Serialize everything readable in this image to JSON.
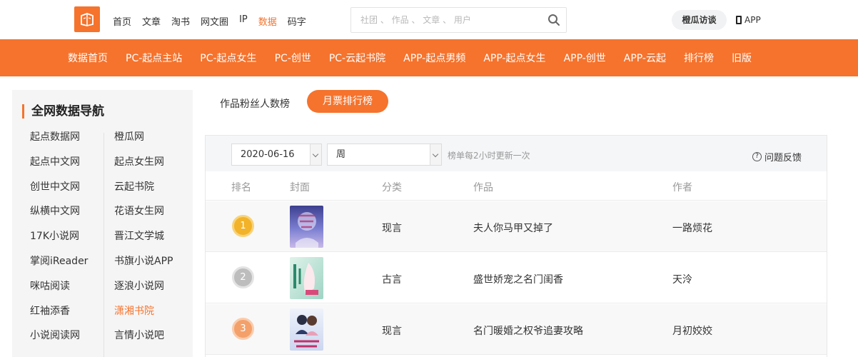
{
  "topbar": {
    "nav": [
      {
        "label": "首页",
        "active": false
      },
      {
        "label": "文章",
        "active": false
      },
      {
        "label": "淘书",
        "active": false
      },
      {
        "label": "网文圈",
        "active": false
      },
      {
        "label": "IP",
        "active": false
      },
      {
        "label": "数据",
        "active": true
      },
      {
        "label": "码字",
        "active": false
      }
    ],
    "search_placeholder": "社团 、 作品 、 文章 、 用户",
    "chengua_label": "橙瓜访谈",
    "app_label": "APP"
  },
  "mainnav": [
    "数据首页",
    "PC-起点主站",
    "PC-起点女生",
    "PC-创世",
    "PC-云起书院",
    "APP-起点男频",
    "APP-起点女生",
    "APP-创世",
    "APP-云起",
    "排行榜",
    "旧版"
  ],
  "sidebar": {
    "title": "全网数据导航",
    "col1": [
      "起点数据网",
      "起点中文网",
      "创世中文网",
      "纵横中文网",
      "17K小说网",
      "掌阅iReader",
      "咪咕阅读",
      "红袖添香",
      "小说阅读网"
    ],
    "col2": [
      "橙瓜网",
      "起点女生网",
      "云起书院",
      "花语女生网",
      "晋江文学城",
      "书旗小说APP",
      "逐浪小说网",
      "潇湘书院",
      "言情小说吧"
    ],
    "active": "潇湘书院"
  },
  "tabs": {
    "fans": "作品粉丝人数榜",
    "monthly": "月票排行榜"
  },
  "filter": {
    "date": "2020-06-16",
    "period": "周",
    "note": "榜单每2小时更新一次",
    "feedback": "问题反馈"
  },
  "table": {
    "headers": {
      "rank": "排名",
      "cover": "封面",
      "category": "分类",
      "title": "作品",
      "author": "作者"
    },
    "rows": [
      {
        "rank": "1",
        "category": "现言",
        "title": "夫人你马甲又掉了",
        "author": "一路烦花"
      },
      {
        "rank": "2",
        "category": "古言",
        "title": "盛世娇宠之名门闺香",
        "author": "天泠"
      },
      {
        "rank": "3",
        "category": "现言",
        "title": "名门暖婚之权爷追妻攻略",
        "author": "月初姣姣"
      }
    ]
  },
  "colors": {
    "accent": "#f5732d"
  }
}
